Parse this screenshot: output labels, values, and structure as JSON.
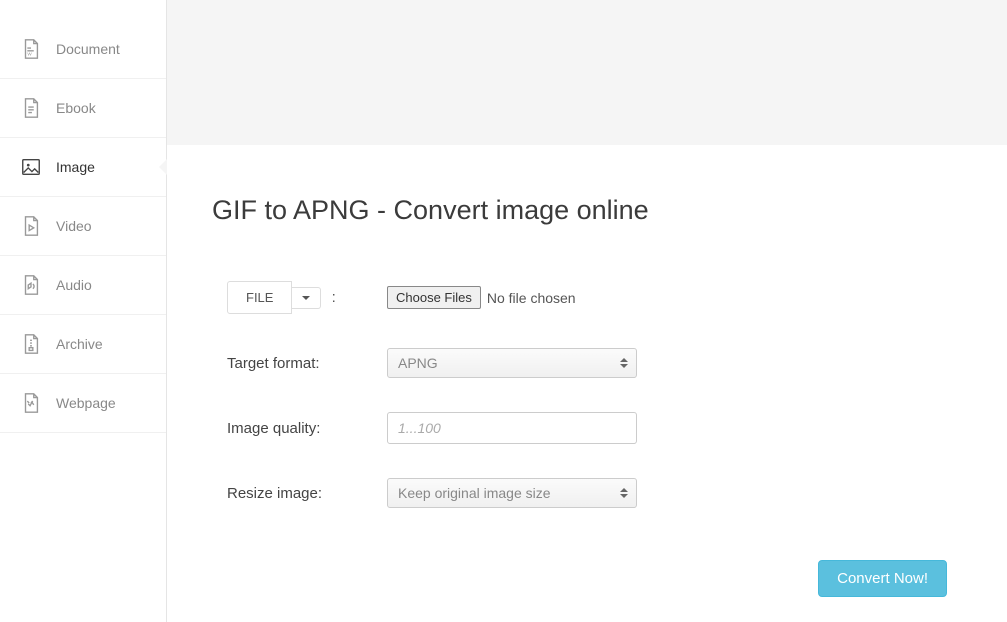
{
  "sidebar": {
    "items": [
      {
        "label": "Document"
      },
      {
        "label": "Ebook"
      },
      {
        "label": "Image"
      },
      {
        "label": "Video"
      },
      {
        "label": "Audio"
      },
      {
        "label": "Archive"
      },
      {
        "label": "Webpage"
      }
    ]
  },
  "page": {
    "title": "GIF to APNG - Convert image online"
  },
  "form": {
    "file_button": "FILE",
    "choose_button": "Choose Files",
    "choose_status": "No file chosen",
    "target_label": "Target format:",
    "target_value": "APNG",
    "quality_label": "Image quality:",
    "quality_placeholder": "1...100",
    "resize_label": "Resize image:",
    "resize_value": "Keep original image size",
    "convert_button": "Convert Now!"
  }
}
